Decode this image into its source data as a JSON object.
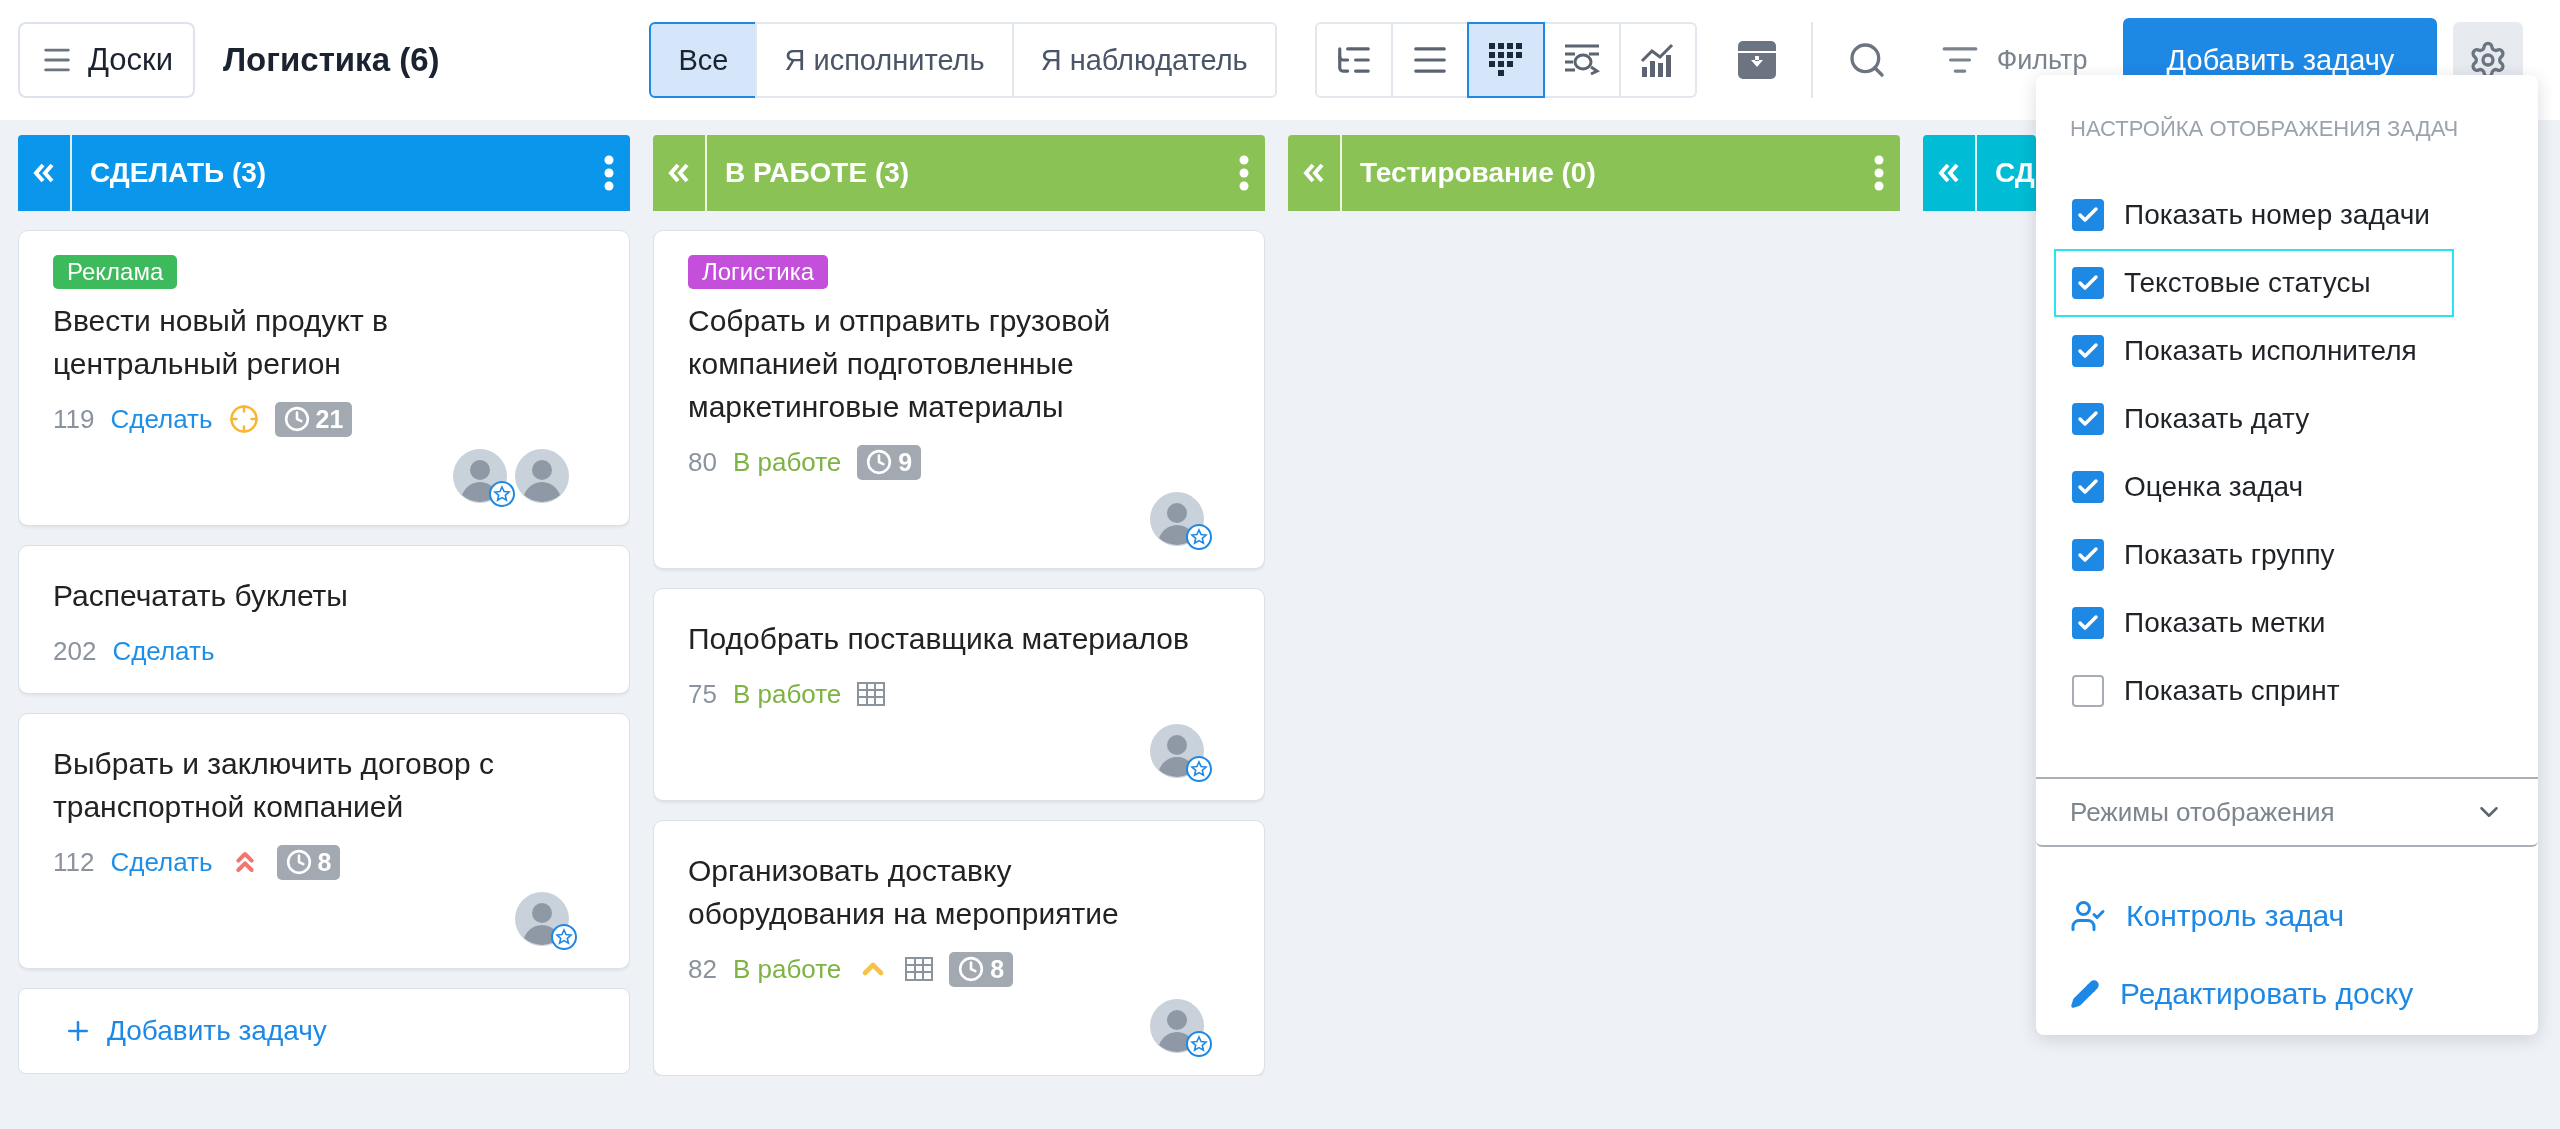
{
  "topbar": {
    "boards_button": "Доски",
    "title": "Логистика (6)",
    "filters": [
      {
        "label": "Все",
        "selected": true
      },
      {
        "label": "Я исполнитель",
        "selected": false
      },
      {
        "label": "Я наблюдатель",
        "selected": false
      }
    ],
    "views": [
      {
        "kind": "tree",
        "selected": false
      },
      {
        "kind": "list",
        "selected": false
      },
      {
        "kind": "kanban",
        "selected": true
      },
      {
        "kind": "timeline",
        "selected": false
      },
      {
        "kind": "chart",
        "selected": false
      }
    ],
    "filter_label": "Фильтр",
    "add_button": "Добавить задачу"
  },
  "columns": [
    {
      "title": "СДЕЛАТЬ (3)",
      "color": "#0a96eb",
      "cards": [
        {
          "tag": {
            "text": "Реклама",
            "color": "#3cba5c"
          },
          "title": "Ввести новый продукт в центральный регион",
          "number": "119",
          "status": {
            "text": "Сделать",
            "color": "#1e8fe6"
          },
          "marks": [
            {
              "kind": "target"
            },
            {
              "kind": "timer",
              "text": "21"
            }
          ],
          "avatars": [
            {
              "starred": true
            },
            {
              "starred": false
            }
          ]
        },
        {
          "title": "Распечатать буклеты",
          "number": "202",
          "status": {
            "text": "Сделать",
            "color": "#1e8fe6"
          }
        },
        {
          "title": "Выбрать и заключить договор с транспортной компанией",
          "number": "112",
          "status": {
            "text": "Сделать",
            "color": "#1e8fe6"
          },
          "marks": [
            {
              "kind": "priority_high"
            },
            {
              "kind": "timer",
              "text": "8"
            }
          ],
          "avatars": [
            {
              "starred": true
            }
          ]
        }
      ],
      "add_task": "Добавить задачу"
    },
    {
      "title": "В РАБОТЕ (3)",
      "color": "#8bc255",
      "cards": [
        {
          "tag": {
            "text": "Логистика",
            "color": "#c34fdb"
          },
          "title": "Собрать и отправить грузовой компанией подготовленные маркетинговые материалы",
          "number": "80",
          "status": {
            "text": "В работе",
            "color": "#7cb342"
          },
          "marks": [
            {
              "kind": "timer",
              "text": "9"
            }
          ],
          "avatars": [
            {
              "starred": true
            }
          ]
        },
        {
          "title": "Подобрать поставщика материалов",
          "number": "75",
          "status": {
            "text": "В работе",
            "color": "#7cb342"
          },
          "marks": [
            {
              "kind": "grid"
            }
          ],
          "avatars": [
            {
              "starred": true
            }
          ]
        },
        {
          "title": "Организовать доставку оборудования на мероприятие",
          "number": "82",
          "status": {
            "text": "В работе",
            "color": "#7cb342"
          },
          "marks": [
            {
              "kind": "priority_low"
            },
            {
              "kind": "grid"
            },
            {
              "kind": "timer",
              "text": "8"
            }
          ],
          "avatars": [
            {
              "starred": true
            }
          ]
        }
      ]
    },
    {
      "title": "Тестирование (0)",
      "color": "#8bc255"
    },
    {
      "title": "СД",
      "color": "#00bcd4"
    }
  ],
  "settings_menu": {
    "title": "НАСТРОЙКА ОТОБРАЖЕНИЯ ЗАДАЧ",
    "options": [
      {
        "label": "Показать номер задачи",
        "checked": true,
        "focused": false
      },
      {
        "label": "Текстовые статусы",
        "checked": true,
        "focused": true
      },
      {
        "label": "Показать исполнителя",
        "checked": true,
        "focused": false
      },
      {
        "label": "Показать дату",
        "checked": true,
        "focused": false
      },
      {
        "label": "Оценка задач",
        "checked": true,
        "focused": false
      },
      {
        "label": "Показать группу",
        "checked": true,
        "focused": false
      },
      {
        "label": "Показать метки",
        "checked": true,
        "focused": false
      },
      {
        "label": "Показать спринт",
        "checked": false,
        "focused": false
      }
    ],
    "modes": {
      "label": "Режимы отображения",
      "expanded": false
    },
    "links": [
      {
        "kind": "control",
        "label": "Контроль задач"
      },
      {
        "kind": "edit",
        "label": "Редактировать доску"
      }
    ]
  }
}
